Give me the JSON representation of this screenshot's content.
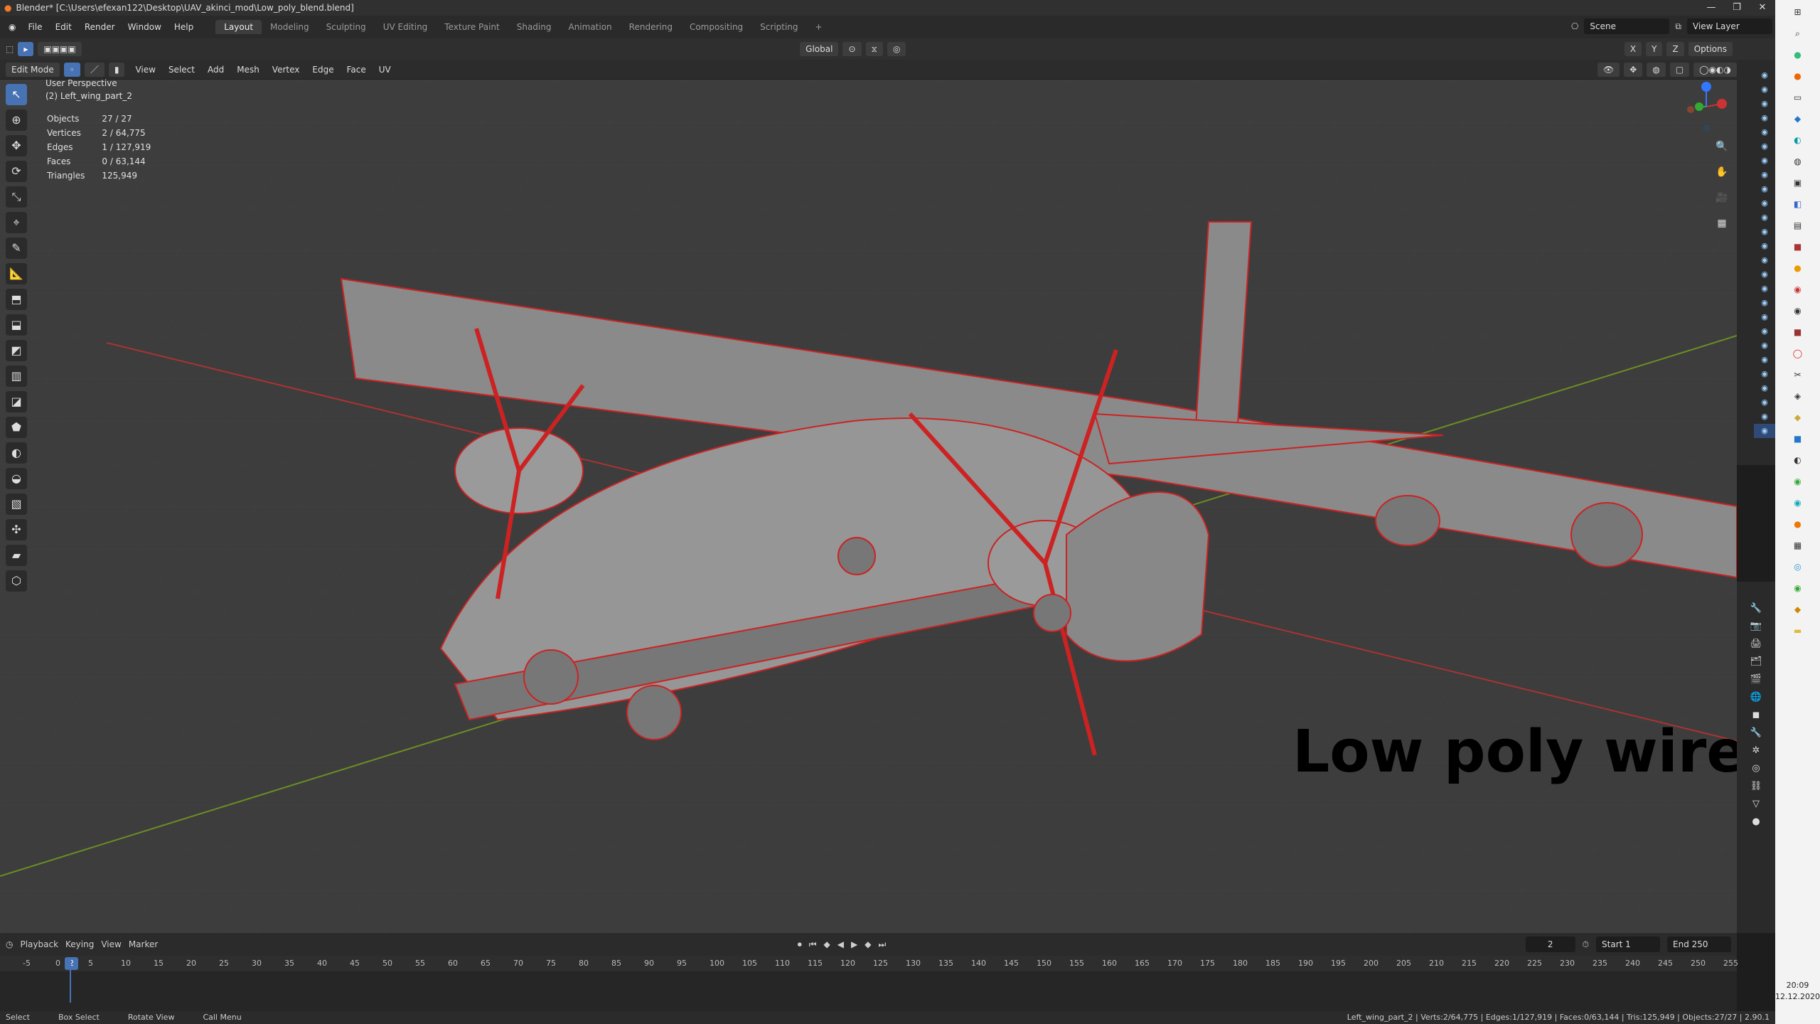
{
  "window": {
    "title": "Blender* [C:\\Users\\efexan122\\Desktop\\UAV_akinci_mod\\Low_poly_blend.blend]",
    "min": "—",
    "max": "❐",
    "close": "✕"
  },
  "menu": [
    "File",
    "Edit",
    "Render",
    "Window",
    "Help"
  ],
  "tabs": [
    "Layout",
    "Modeling",
    "Sculpting",
    "UV Editing",
    "Texture Paint",
    "Shading",
    "Animation",
    "Rendering",
    "Compositing",
    "Scripting"
  ],
  "active_tab": "Layout",
  "scene": {
    "label": "Scene",
    "view_layer": "View Layer"
  },
  "view_toolbar": {
    "mode": "Edit Mode",
    "menus": [
      "View",
      "Select",
      "Add",
      "Mesh",
      "Vertex",
      "Edge",
      "Face",
      "UV"
    ],
    "transform": "Global",
    "options": "Options",
    "axes": [
      "X",
      "Y",
      "Z"
    ]
  },
  "viewport": {
    "perspective": "User Perspective",
    "object": "(2) Left_wing_part_2",
    "stats": [
      {
        "k": "Objects",
        "v": "27 / 27"
      },
      {
        "k": "Vertices",
        "v": "2 / 64,775"
      },
      {
        "k": "Edges",
        "v": "1 / 127,919"
      },
      {
        "k": "Faces",
        "v": "0 / 63,144"
      },
      {
        "k": "Triangles",
        "v": "125,949"
      }
    ],
    "caption": "Low poly wire"
  },
  "timeline": {
    "menus": [
      "Playback",
      "Keying",
      "View",
      "Marker"
    ],
    "current_frame": "2",
    "start_label": "Start",
    "start": "1",
    "end_label": "End",
    "end": "250",
    "ticks": [
      "-5",
      "0",
      "5",
      "10",
      "15",
      "20",
      "25",
      "30",
      "35",
      "40",
      "45",
      "50",
      "55",
      "60",
      "65",
      "70",
      "75",
      "80",
      "85",
      "90",
      "95",
      "100",
      "105",
      "110",
      "115",
      "120",
      "125",
      "130",
      "135",
      "140",
      "145",
      "150",
      "155",
      "160",
      "165",
      "170",
      "175",
      "180",
      "185",
      "190",
      "195",
      "200",
      "205",
      "210",
      "215",
      "220",
      "225",
      "230",
      "235",
      "240",
      "245",
      "250",
      "255"
    ]
  },
  "status": {
    "select": "Select",
    "box_select": "Box Select",
    "rotate": "Rotate View",
    "call_menu": "Call Menu",
    "info": "Left_wing_part_2 | Verts:2/64,775 | Edges:1/127,919 | Faces:0/63,144 | Tris:125,949 | Objects:27/27 | 2.90.1"
  },
  "taskbar": {
    "time": "20:09",
    "date": "12.12.2020"
  }
}
